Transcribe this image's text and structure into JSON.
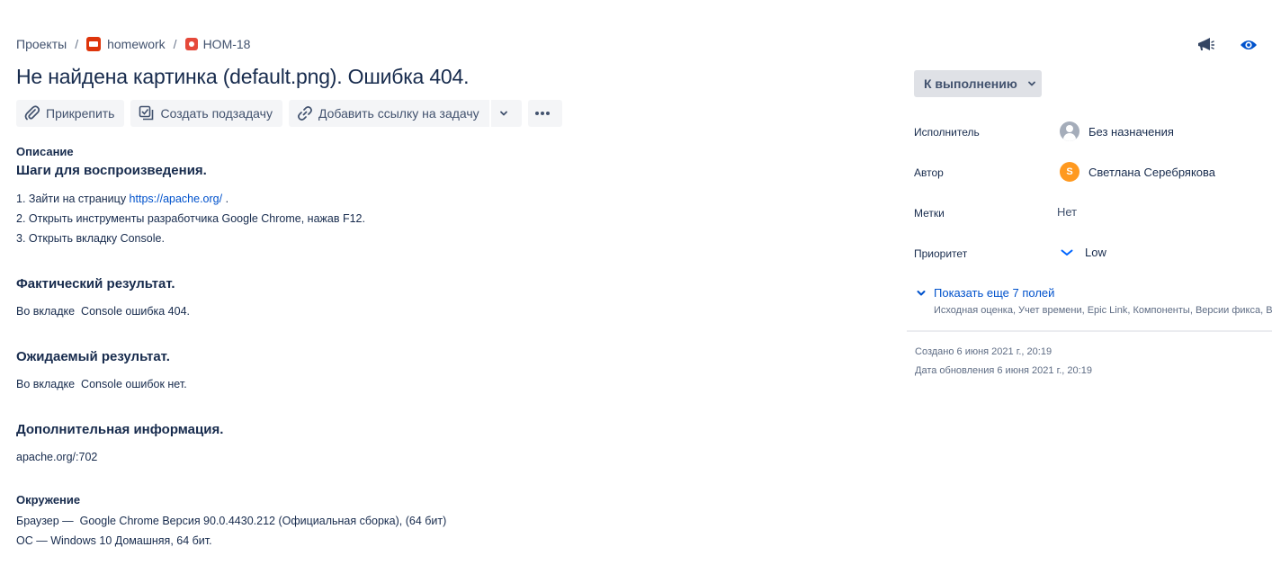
{
  "breadcrumb": {
    "projects": "Проекты",
    "separator": "/",
    "project": "homework",
    "issue_key": "HOM-18"
  },
  "issue": {
    "title": "Не найдена картинка (default.png). Ошибка 404."
  },
  "toolbar": {
    "attach": "Прикрепить",
    "create_subtask": "Создать подзадачу",
    "link_issue": "Добавить ссылку на задачу"
  },
  "description": {
    "label": "Описание",
    "steps_heading": "Шаги для воспроизведения.",
    "step1_prefix": "1. Зайти на страницу ",
    "step1_link": "https://apache.org/",
    "step1_suffix": " .",
    "step2": "2. Открыть инструменты разработчика Google Chrome, нажав F12.",
    "step3": "3. Открыть вкладку Console.",
    "actual_heading": "Фактический результат.",
    "actual_text": "Во вкладке  Console ошибка 404.",
    "expected_heading": "Ожидаемый результат.",
    "expected_text": "Во вкладке  Console ошибок нет.",
    "additional_heading": "Дополнительная информация.",
    "additional_text": "apache.org/:702"
  },
  "environment": {
    "label": "Окружение",
    "browser": "Браузер —  Google Chrome Версия 90.0.4430.212 (Официальная сборка), (64 бит)",
    "os": "ОС — Windows 10 Домашняя, 64 бит."
  },
  "sidebar": {
    "status": "К выполнению",
    "assignee_label": "Исполнитель",
    "assignee_value": "Без назначения",
    "reporter_label": "Автор",
    "reporter_initial": "S",
    "reporter_value": "Светлана Серебрякова",
    "labels_label": "Метки",
    "labels_value": "Нет",
    "priority_label": "Приоритет",
    "priority_value": "Low",
    "show_more": "Показать еще 7 полей",
    "show_more_sub": "Исходная оценка, Учет времени, Epic Link, Компоненты, Версии фикса, Ве",
    "created": "Создано 6 июня 2021 г., 20:19",
    "updated": "Дата обновления 6 июня 2021 г., 20:19"
  },
  "colors": {
    "accent": "#0052CC",
    "text": "#172B4D",
    "button_bg": "#F4F5F7",
    "status_bg": "#DFE1E6",
    "avatar_orange": "#FF991F",
    "bug_red": "#E5493A"
  },
  "icons": [
    "project-icon",
    "bug-icon",
    "megaphone-icon",
    "eye-icon",
    "paperclip-icon",
    "subtask-icon",
    "link-icon",
    "chevron-down-icon",
    "more-icon",
    "user-icon",
    "priority-low-icon"
  ]
}
